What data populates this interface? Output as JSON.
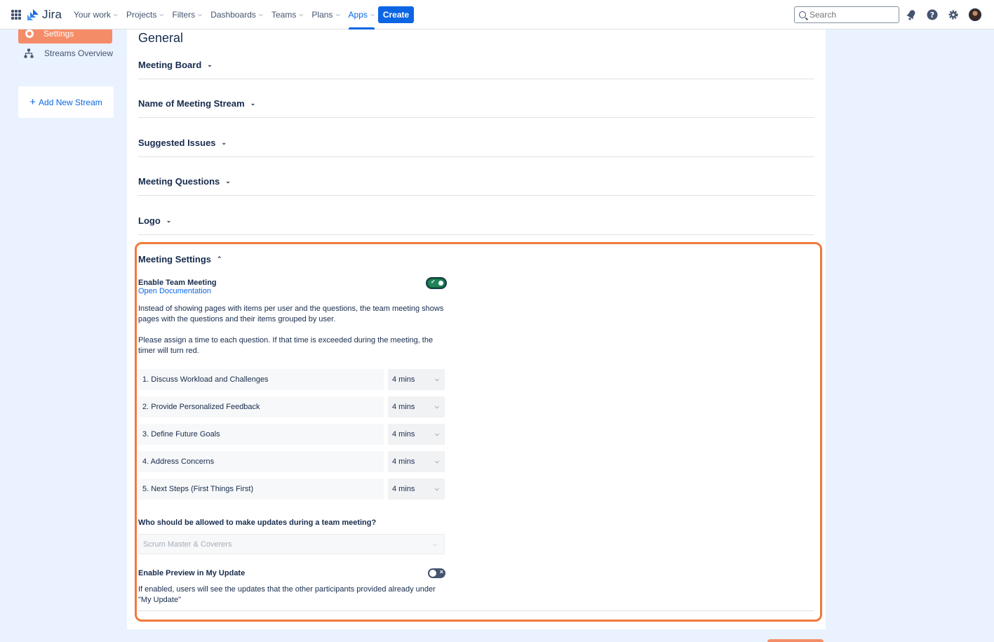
{
  "nav": {
    "brand": "Jira",
    "items": [
      {
        "label": "Your work",
        "active": false
      },
      {
        "label": "Projects",
        "active": false
      },
      {
        "label": "Filters",
        "active": false
      },
      {
        "label": "Dashboards",
        "active": false
      },
      {
        "label": "Teams",
        "active": false
      },
      {
        "label": "Plans",
        "active": false
      },
      {
        "label": "Apps",
        "active": true
      }
    ],
    "create_label": "Create",
    "search_placeholder": "Search",
    "icons": [
      "notification-icon",
      "help-icon",
      "settings-icon",
      "avatar"
    ]
  },
  "sidebar": {
    "settings_label": "Settings",
    "streams_overview_label": "Streams Overview",
    "add_stream_label": "Add New Stream"
  },
  "main": {
    "title": "General",
    "sections": [
      {
        "label": "Meeting Board"
      },
      {
        "label": "Name of Meeting Stream"
      },
      {
        "label": "Suggested Issues"
      },
      {
        "label": "Meeting Questions"
      },
      {
        "label": "Logo"
      }
    ],
    "meeting_settings": {
      "label": "Meeting Settings",
      "enable_team_meeting_label": "Enable Team Meeting",
      "enable_team_meeting_on": true,
      "doc_link": "Open Documentation",
      "description": "Instead of showing pages with items per user and the questions, the team meeting shows pages with the questions and their items grouped by user.",
      "time_instruction": "Please assign a time to each question. If that time is exceeded during the meeting, the timer will turn red.",
      "questions": [
        {
          "label": "1. Discuss Workload and Challenges",
          "time": "4 mins"
        },
        {
          "label": "2. Provide Personalized Feedback",
          "time": "4 mins"
        },
        {
          "label": "3. Define Future Goals",
          "time": "4 mins"
        },
        {
          "label": "4. Address Concerns",
          "time": "4 mins"
        },
        {
          "label": "5. Next Steps (First Things First)",
          "time": "4 mins"
        }
      ],
      "permission_question": "Who should be allowed to make updates during a team meeting?",
      "permission_value": "Scrum Master & Coverers",
      "preview_label": "Enable Preview in My Update",
      "preview_on": false,
      "preview_description": "If enabled, users will see the updates that the other participants provided already under \"My Update\""
    }
  },
  "colors": {
    "accent": "#0c66e4",
    "sidebar_active": "#f58c68",
    "highlight": "#f07a3a",
    "toggle_on": "#1f845a"
  }
}
